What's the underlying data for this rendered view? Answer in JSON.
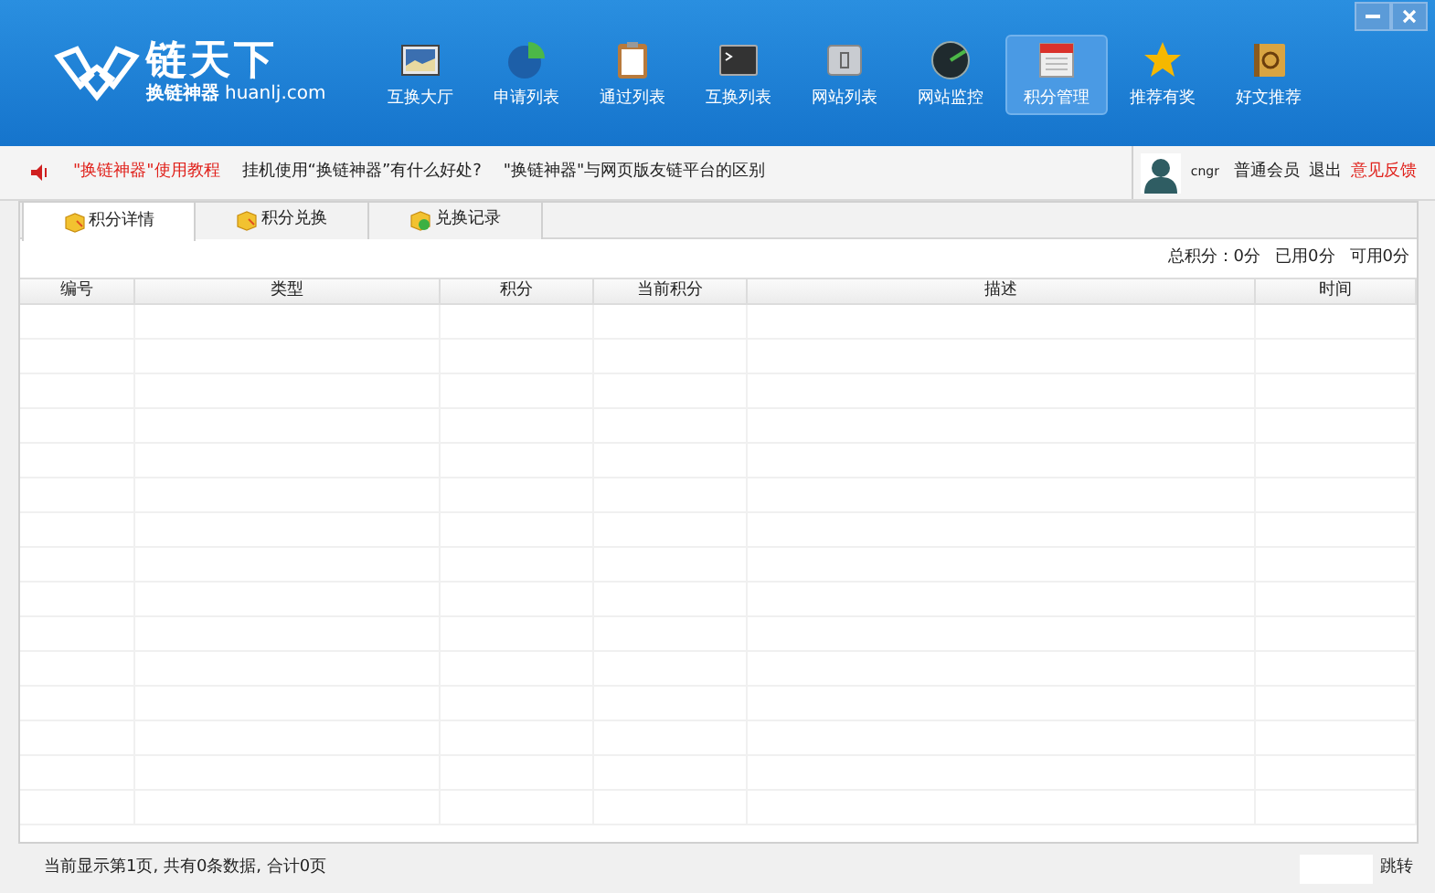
{
  "logo": {
    "title": "链天下",
    "subtitle": "换链神器",
    "domain": "huanlj.com"
  },
  "nav": [
    {
      "label": "互换大厅",
      "selected": false
    },
    {
      "label": "申请列表",
      "selected": false
    },
    {
      "label": "通过列表",
      "selected": false
    },
    {
      "label": "互换列表",
      "selected": false
    },
    {
      "label": "网站列表",
      "selected": false
    },
    {
      "label": "网站监控",
      "selected": false
    },
    {
      "label": "积分管理",
      "selected": true
    },
    {
      "label": "推荐有奖",
      "selected": false
    },
    {
      "label": "好文推荐",
      "selected": false
    }
  ],
  "notices": [
    {
      "text": "\"换链神器\"使用教程",
      "highlight": true
    },
    {
      "text": "挂机使用“换链神器”有什么好处?",
      "highlight": false
    },
    {
      "text": "\"换链神器\"与网页版友链平台的区别",
      "highlight": false
    }
  ],
  "user": {
    "name": "cngr",
    "level": "普通会员",
    "logout": "退出",
    "feedback": "意见反馈"
  },
  "tabs": [
    {
      "label": "积分详情",
      "selected": true
    },
    {
      "label": "积分兑换",
      "selected": false
    },
    {
      "label": "兑换记录",
      "selected": false
    }
  ],
  "summary": [
    "总积分：0分",
    "已用0分",
    "可用0分"
  ],
  "table": {
    "columns": [
      "编号",
      "类型",
      "积分",
      "当前积分",
      "描述",
      "时间"
    ]
  },
  "status_bar": {
    "text": "当前显示第1页, 共有0条数据, 合计0页",
    "jump": "跳转"
  }
}
